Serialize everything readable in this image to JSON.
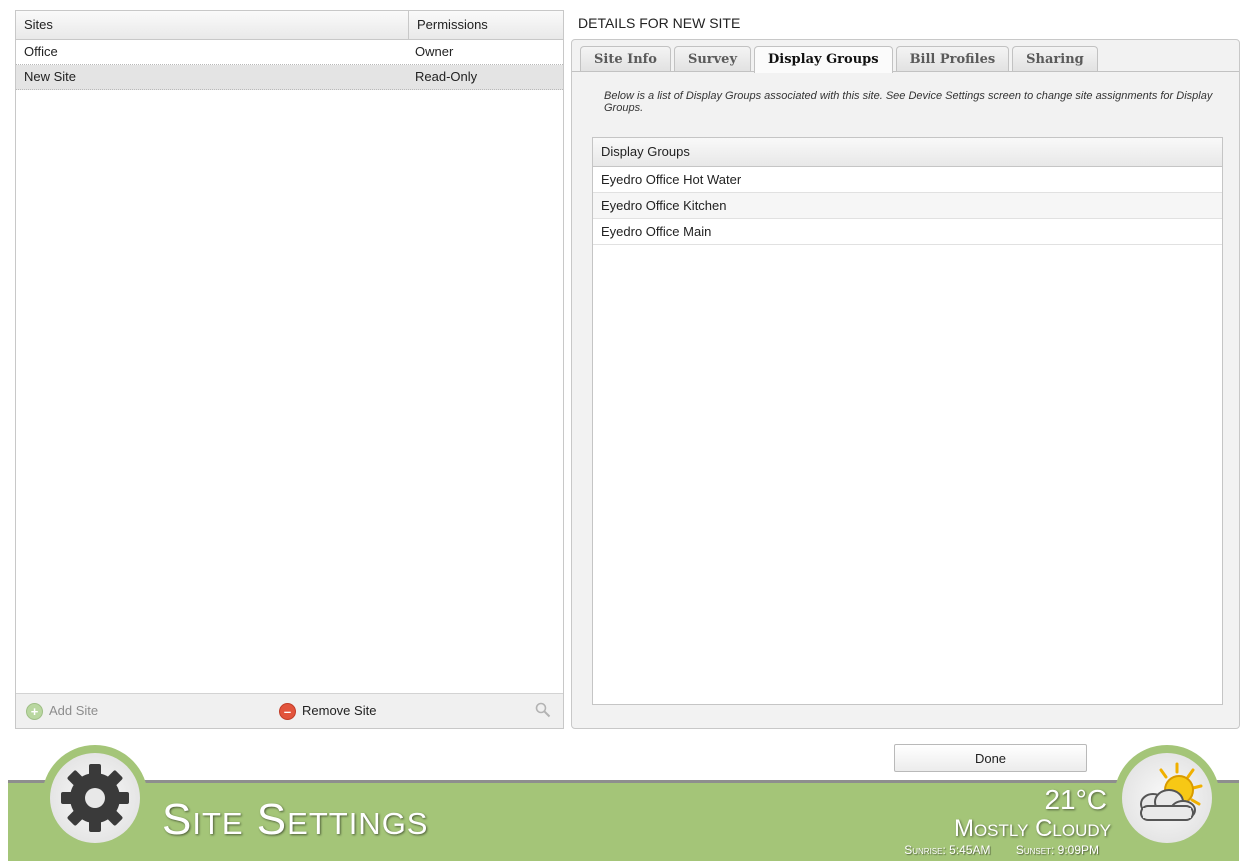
{
  "sites": {
    "columns": {
      "name": "Sites",
      "permissions": "Permissions"
    },
    "rows": [
      {
        "name": "Office",
        "permission": "Owner",
        "selected": false
      },
      {
        "name": "New Site",
        "permission": "Read-Only",
        "selected": true
      }
    ],
    "footer": {
      "add_label": "Add Site",
      "remove_label": "Remove Site"
    }
  },
  "details": {
    "title": "DETAILS FOR NEW SITE",
    "tabs": [
      {
        "label": "Site Info",
        "active": false
      },
      {
        "label": "Survey",
        "active": false
      },
      {
        "label": "Display Groups",
        "active": true
      },
      {
        "label": "Bill Profiles",
        "active": false
      },
      {
        "label": "Sharing",
        "active": false
      }
    ],
    "description": "Below is a list of Display Groups associated with this site. See Device Settings screen to change site assignments for Display Groups.",
    "table_header": "Display Groups",
    "groups": [
      "Eyedro Office Hot Water",
      "Eyedro Office Kitchen",
      "Eyedro Office Main"
    ]
  },
  "done_label": "Done",
  "banner": {
    "title": "Site Settings",
    "temperature": "21°C",
    "condition": "Mostly Cloudy",
    "sunrise": "Sunrise: 5:45AM",
    "sunset": "Sunset: 9:09PM",
    "left_icon": "gear-icon",
    "right_icon": "partly-cloudy-icon"
  },
  "colors": {
    "banner_green": "#a4c578",
    "remove_red": "#e2543c",
    "add_green": "#b9d7a0"
  }
}
